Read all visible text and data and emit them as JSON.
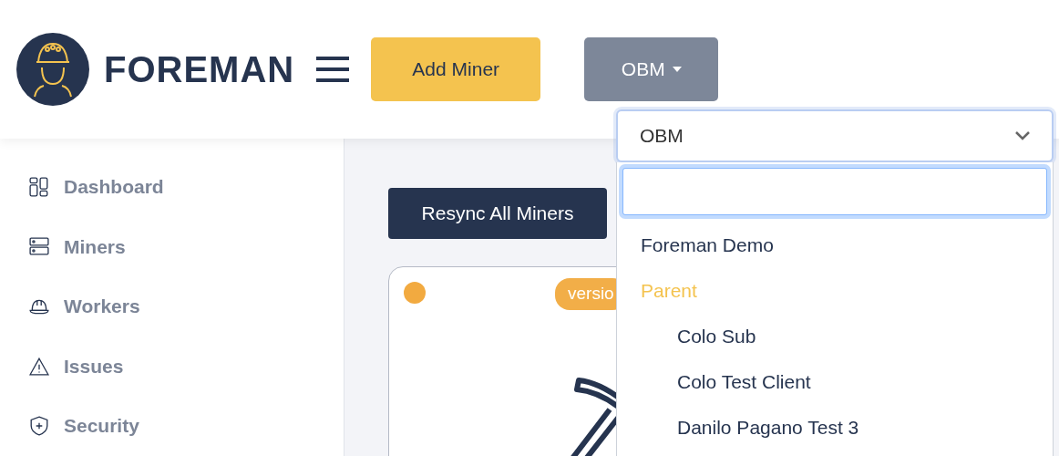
{
  "header": {
    "logo_text": "FOREMAN",
    "add_button": "Add Miner",
    "org_button": "OBM"
  },
  "sidebar": {
    "items": [
      {
        "label": "Dashboard",
        "kind": "dashboard"
      },
      {
        "label": "Miners",
        "kind": "server"
      },
      {
        "label": "Workers",
        "kind": "helmet"
      },
      {
        "label": "Issues",
        "kind": "warning"
      },
      {
        "label": "Security",
        "kind": "shield"
      }
    ]
  },
  "main": {
    "resync_button": "Resync All Miners",
    "card": {
      "color": "#f2aa40",
      "badge": "versio"
    }
  },
  "org_select": {
    "value": "OBM",
    "options": [
      {
        "label": "Foreman Demo",
        "kind": "option"
      },
      {
        "label": "Parent",
        "kind": "group",
        "children": [
          {
            "label": "Colo Sub",
            "kind": "option"
          },
          {
            "label": "Colo Test Client",
            "kind": "option"
          },
          {
            "label": "Danilo Pagano Test 3",
            "kind": "option"
          }
        ]
      }
    ]
  }
}
